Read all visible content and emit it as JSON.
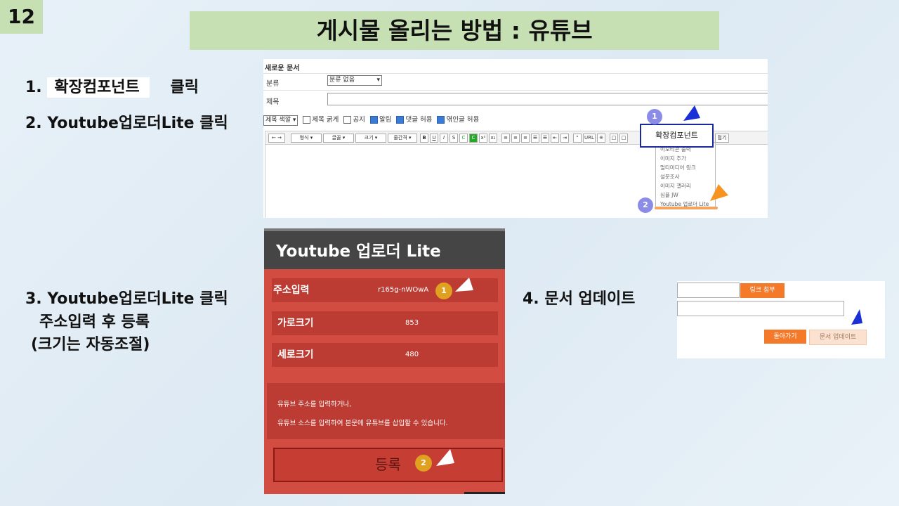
{
  "slide_number": "12",
  "title": "게시물 올리는 방법 : 유튜브",
  "steps": {
    "s1_prefix": "1.",
    "s1_chip": "확장컴포넌트",
    "s1_suffix": "클릭",
    "s2": "2. Youtube업로더Lite  클릭",
    "s3_line1": "3. Youtube업로더Lite  클릭",
    "s3_line2": "주소입력 후 등록",
    "s3_line3": "(크기는 자동조절)",
    "s4": "4. 문서 업데이트"
  },
  "editor": {
    "header": "새로운 문서",
    "category_label": "분류",
    "category_value": "분류 없음",
    "title_label": "제목",
    "title_color": "제목 색깔",
    "options": [
      "제목 굵게",
      "공지",
      "알림",
      "댓글 허용",
      "엮인글 허용"
    ],
    "options_checked": [
      false,
      false,
      true,
      true,
      true
    ],
    "toolbar": [
      "형식",
      "글꼴",
      "크기",
      "줄간격"
    ],
    "toolbar_tail": "접기",
    "extension_label": "확장컴포넌트",
    "dropdown_items": [
      "이모티콘 출력",
      "이미지 추가",
      "멀티미디어 링크",
      "설문조사",
      "이미지 갤러리",
      "심플 JW",
      "Youtube 업로더 Lite"
    ],
    "badges": [
      "1",
      "2"
    ]
  },
  "uploader": {
    "title": "Youtube 업로더 Lite",
    "address_label": "주소입력",
    "address_value": "r165g-nWOwA",
    "width_label": "가로크기",
    "width_value": "853",
    "height_label": "세로크기",
    "height_value": "480",
    "info_line1": "유튜브 주소를 입력하거나,",
    "info_line2": "유튜브 소스를 입력하여 본문에 유튜브를 삽입할 수 있습니다.",
    "register_label": "등록",
    "badges": [
      "1",
      "2"
    ]
  },
  "update_panel": {
    "link_button": "링크 첨부",
    "back_button": "돌아가기",
    "update_button": "문서 업데이트"
  },
  "colors": {
    "title_bg": "#c6e0b4",
    "uploader_red": "#d24c41",
    "accent_orange": "#f47a2a",
    "pointer_blue": "#1a2fd6",
    "pointer_orange": "#f7931e"
  }
}
